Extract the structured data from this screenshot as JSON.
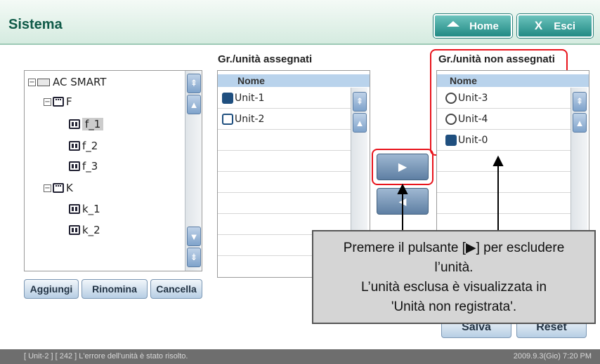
{
  "header": {
    "title": "Sistema",
    "home_label": "Home",
    "exit_label": "Esci"
  },
  "tree": {
    "root": "AC SMART",
    "items": [
      "F",
      "f_1",
      "f_2",
      "f_3",
      "K",
      "k_1",
      "k_2"
    ],
    "selected": "f_1"
  },
  "tree_buttons": {
    "add": "Aggiungi",
    "rename": "Rinomina",
    "delete": "Cancella"
  },
  "assigned": {
    "header": "Gr./unità assegnati",
    "col": "Nome",
    "rows": [
      "Unit-1",
      "Unit-2"
    ]
  },
  "unassigned": {
    "header": "Gr./unità non assegnati",
    "col": "Nome",
    "rows": [
      "Unit-3",
      "Unit-4",
      "Unit-0"
    ]
  },
  "move": {
    "right_glyph": "▶"
  },
  "footer_buttons": {
    "save": "Salva",
    "reset": "Reset"
  },
  "tooltip": {
    "line1": "Premere il pulsante [▶] per escludere",
    "line2": "l’unità.",
    "line3": "L’unità esclusa è visualizzata in",
    "line4": "'Unità non registrata'."
  },
  "status": {
    "message": "[ Unit-2 ] [ 242 ] L'errore dell'unità è stato risolto.",
    "datetime": "2009.9.3(Gio) 7:20 PM"
  },
  "colors": {
    "accent": "#218a84",
    "highlight": "#e8141c"
  }
}
